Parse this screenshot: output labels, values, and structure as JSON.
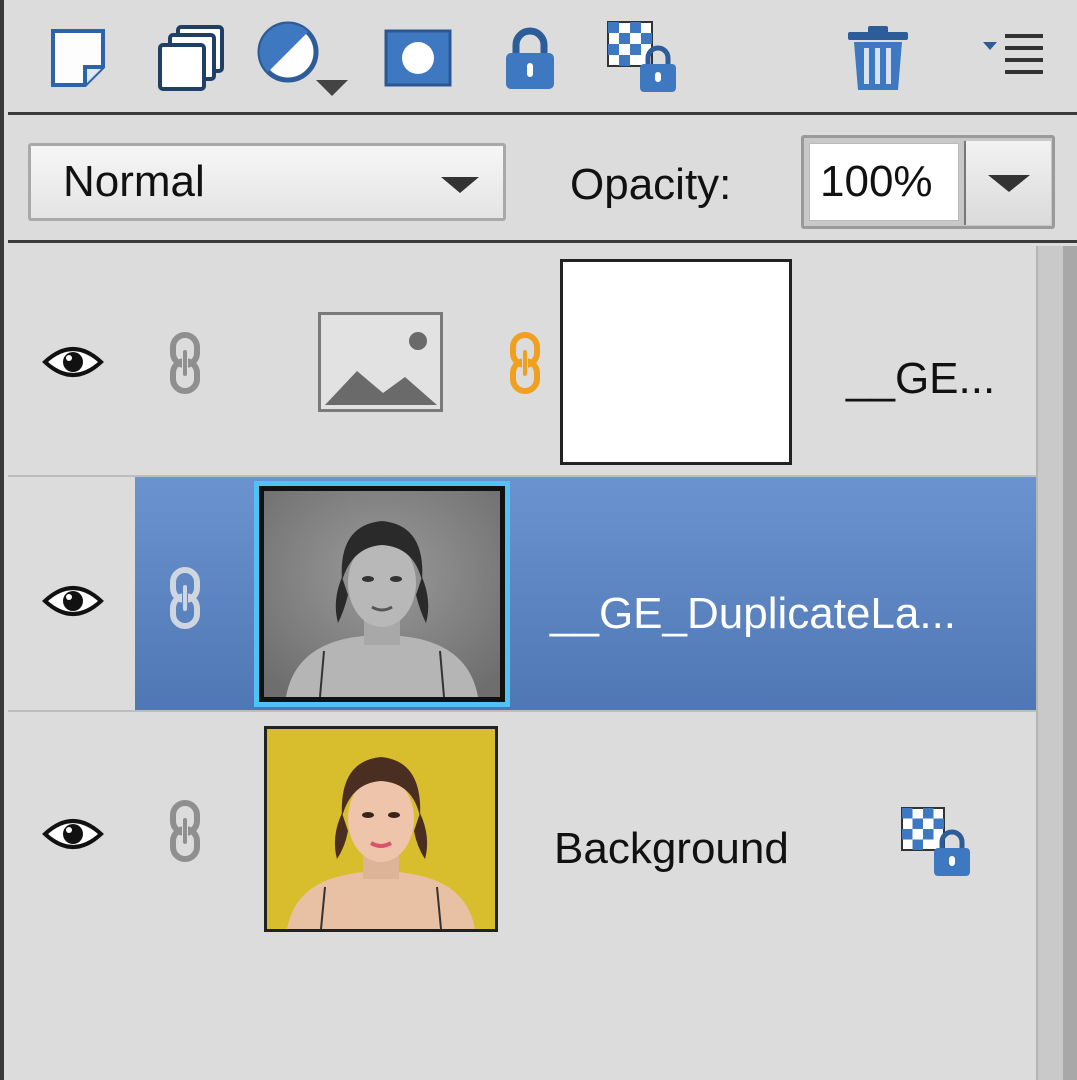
{
  "toolbar": {
    "buttons": [
      {
        "name": "new-layer-icon"
      },
      {
        "name": "new-group-icon"
      },
      {
        "name": "adjustment-layer-icon"
      },
      {
        "name": "layer-mask-icon"
      },
      {
        "name": "lock-all-icon"
      },
      {
        "name": "lock-transparency-icon"
      },
      {
        "name": "trash-icon"
      },
      {
        "name": "panel-menu-icon"
      }
    ]
  },
  "blend": {
    "mode": "Normal",
    "opacity_label": "Opacity:",
    "opacity_value": "100%"
  },
  "layers": [
    {
      "name": "__GE...",
      "visible": true,
      "linked": true,
      "has_mask": true,
      "selected": false
    },
    {
      "name": "__GE_DuplicateLa...",
      "visible": true,
      "linked": true,
      "selected": true
    },
    {
      "name": "Background",
      "visible": true,
      "linked": true,
      "locked": true,
      "selected": false
    }
  ],
  "colors": {
    "selection": "#5d86c4",
    "selection_border": "#4fc3f5",
    "mask_link": "#f0a020",
    "icon_blue": "#4a7fc1"
  }
}
